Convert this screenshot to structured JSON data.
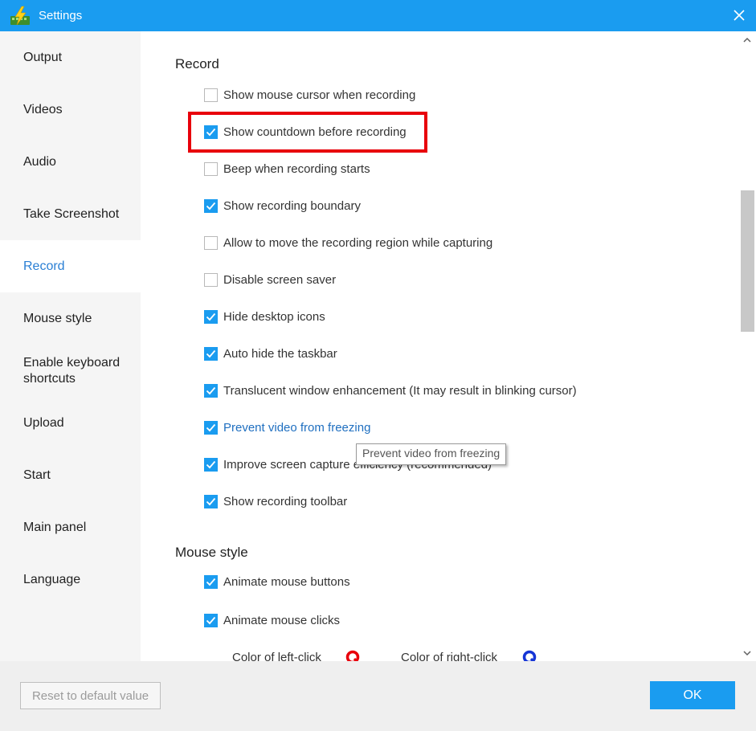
{
  "window": {
    "title": "Settings",
    "app_icon": "lightning-film-app-icon",
    "close_icon": "close-icon"
  },
  "sidebar": {
    "items": [
      {
        "label": "Output",
        "active": false
      },
      {
        "label": "Videos",
        "active": false
      },
      {
        "label": "Audio",
        "active": false
      },
      {
        "label": "Take Screenshot",
        "active": false
      },
      {
        "label": "Record",
        "active": true
      },
      {
        "label": "Mouse style",
        "active": false
      },
      {
        "label": "Enable keyboard shortcuts",
        "active": false
      },
      {
        "label": "Upload",
        "active": false
      },
      {
        "label": "Start",
        "active": false
      },
      {
        "label": "Main panel",
        "active": false
      },
      {
        "label": "Language",
        "active": false
      }
    ]
  },
  "record": {
    "title": "Record",
    "options": [
      {
        "label": "Show mouse cursor when recording",
        "checked": false
      },
      {
        "label": "Show countdown before recording",
        "checked": true
      },
      {
        "label": "Beep when recording starts",
        "checked": false
      },
      {
        "label": "Show recording boundary",
        "checked": true
      },
      {
        "label": "Allow to move the recording region while capturing",
        "checked": false
      },
      {
        "label": "Disable screen saver",
        "checked": false
      },
      {
        "label": "Hide desktop icons",
        "checked": true
      },
      {
        "label": "Auto hide the taskbar",
        "checked": true
      },
      {
        "label": "Translucent window enhancement (It may result in blinking cursor)",
        "checked": true
      },
      {
        "label": "Prevent video from freezing",
        "checked": true
      },
      {
        "label": "Improve screen capture efficiency (recommended)",
        "checked": true
      },
      {
        "label": "Show recording toolbar",
        "checked": true
      }
    ]
  },
  "tooltip": {
    "text": "Prevent video from freezing"
  },
  "mouse_style": {
    "title": "Mouse style",
    "options": [
      {
        "label": "Animate mouse buttons",
        "checked": true
      },
      {
        "label": "Animate mouse clicks",
        "checked": true
      }
    ],
    "left_click_label": "Color of left-click",
    "right_click_label": "Color of right-click",
    "left_click_color": "#e8000b",
    "right_click_color": "#1535d6"
  },
  "footer": {
    "reset_label": "Reset to default value",
    "ok_label": "OK"
  },
  "colors": {
    "accent": "#1a9cf0",
    "highlight": "#e8000b",
    "active_nav_text": "#2a7fd4"
  }
}
